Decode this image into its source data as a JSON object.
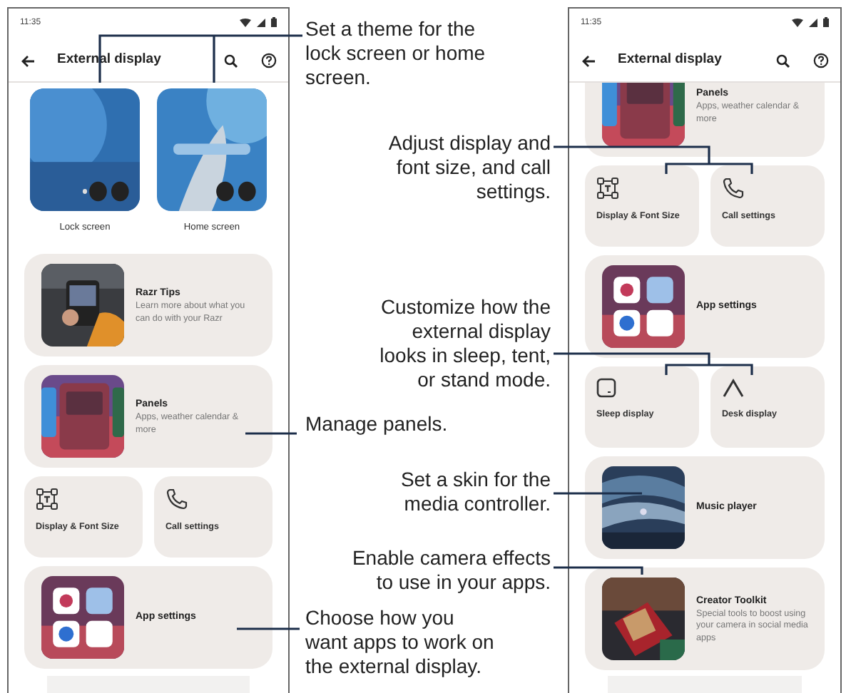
{
  "screens": [
    {
      "status_time": "11:35",
      "title": "External display",
      "sections": [
        {
          "kind": "themes",
          "options": [
            {
              "label": "Lock screen"
            },
            {
              "label": "Home screen"
            }
          ]
        },
        {
          "kind": "card",
          "title": "Razr Tips",
          "subtitle": "Learn more about what you can do with your Razr"
        },
        {
          "kind": "card",
          "title": "Panels",
          "subtitle": "Apps, weather calendar & more"
        },
        {
          "kind": "tiles",
          "tiles": [
            {
              "label": "Display & Font Size"
            },
            {
              "label": "Call settings"
            }
          ]
        },
        {
          "kind": "card",
          "title": "App settings"
        }
      ]
    },
    {
      "status_time": "11:35",
      "title": "External display",
      "sections": [
        {
          "kind": "card",
          "title": "Panels",
          "subtitle": "Apps, weather calendar & more"
        },
        {
          "kind": "tiles",
          "tiles": [
            {
              "label": "Display & Font Size"
            },
            {
              "label": "Call settings"
            }
          ]
        },
        {
          "kind": "card",
          "title": "App settings"
        },
        {
          "kind": "tiles",
          "tiles": [
            {
              "label": "Sleep display"
            },
            {
              "label": "Desk display"
            }
          ]
        },
        {
          "kind": "card",
          "title": "Music player"
        },
        {
          "kind": "card",
          "title": "Creator Toolkit",
          "subtitle": "Special tools to boost using your camera in social media apps"
        }
      ]
    }
  ],
  "callouts": [
    {
      "text": "Set a theme for the lock screen or home screen.",
      "kind": "left"
    },
    {
      "text": "Adjust display and font size, and call settings.",
      "kind": "right"
    },
    {
      "text": "Customize how the external display looks in sleep, tent, or stand mode.",
      "kind": "right"
    },
    {
      "text": "Manage panels.",
      "kind": "left"
    },
    {
      "text": "Set a skin for the media controller.",
      "kind": "right"
    },
    {
      "text": "Enable camera effects to use in your apps.",
      "kind": "right"
    },
    {
      "text": "Choose how you want apps to work on the external display.",
      "kind": "left"
    }
  ]
}
